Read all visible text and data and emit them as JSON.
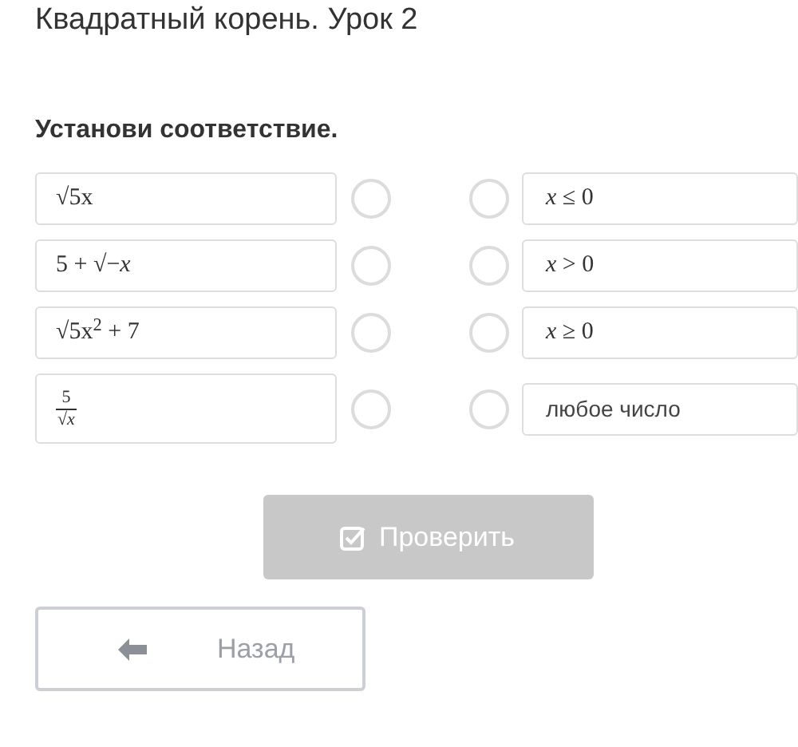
{
  "title": "Квадратный корень. Урок 2",
  "instruction": "Установи соответствие.",
  "left_items": [
    {
      "kind": "formula",
      "text": "√5x",
      "selected": false
    },
    {
      "kind": "formula",
      "text": "5 + √−*x*",
      "selected": false
    },
    {
      "kind": "formula",
      "text": "√5x$^{2}$ + 7",
      "selected": false
    },
    {
      "kind": "fraction",
      "numerator": "5",
      "denominator": "√*x*",
      "selected": false
    }
  ],
  "right_items": [
    {
      "kind": "formula",
      "text": "*x* ≤ 0",
      "selected": false
    },
    {
      "kind": "formula",
      "text": "*x* > 0",
      "selected": false
    },
    {
      "kind": "formula",
      "text": "*x* ≥ 0",
      "selected": false
    },
    {
      "kind": "text",
      "text": "любое число",
      "selected": false
    }
  ],
  "check_button": {
    "label": "Проверить",
    "disabled": true
  },
  "back_button": {
    "label": "Назад"
  }
}
